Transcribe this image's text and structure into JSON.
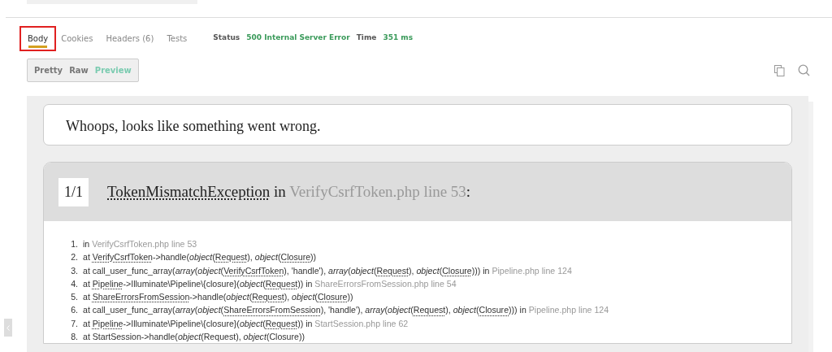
{
  "tabs": [
    {
      "label": "Body",
      "selected": true,
      "annotated": true
    },
    {
      "label": "Cookies",
      "selected": false,
      "annotated": false
    },
    {
      "label": "Headers (6)",
      "selected": false,
      "annotated": false
    },
    {
      "label": "Tests",
      "selected": false,
      "annotated": false
    }
  ],
  "status": {
    "label": "Status",
    "value": "500 Internal Server Error",
    "time_label": "Time",
    "time_value": "351 ms"
  },
  "view_modes": [
    {
      "label": "Pretty",
      "selected": false
    },
    {
      "label": "Raw",
      "selected": false
    },
    {
      "label": "Preview",
      "selected": true
    }
  ],
  "preview": {
    "title": "Whoops, looks like something went wrong.",
    "exception": {
      "count": "1/1",
      "parts": [
        {
          "kind": "abbr",
          "text": "TokenMismatchException"
        },
        {
          "kind": "text",
          "text": " in "
        },
        {
          "kind": "file",
          "text": "VerifyCsrfToken.php line 53"
        },
        {
          "kind": "text",
          "text": ":"
        }
      ]
    },
    "trace": [
      {
        "number": "1.",
        "parts": [
          {
            "kind": "text",
            "text": "in "
          },
          {
            "kind": "file",
            "text": "VerifyCsrfToken.php line 53"
          }
        ]
      },
      {
        "number": "2.",
        "parts": [
          {
            "kind": "text",
            "text": "at "
          },
          {
            "kind": "abbr",
            "text": "VerifyCsrfToken"
          },
          {
            "kind": "text",
            "text": "->handle("
          },
          {
            "kind": "italic",
            "text": "object"
          },
          {
            "kind": "text",
            "text": "("
          },
          {
            "kind": "abbr",
            "text": "Request"
          },
          {
            "kind": "text",
            "text": "), "
          },
          {
            "kind": "italic",
            "text": "object"
          },
          {
            "kind": "text",
            "text": "("
          },
          {
            "kind": "abbr",
            "text": "Closure"
          },
          {
            "kind": "text",
            "text": "))"
          }
        ]
      },
      {
        "number": "3.",
        "parts": [
          {
            "kind": "text",
            "text": "at call_user_func_array("
          },
          {
            "kind": "italic",
            "text": "array"
          },
          {
            "kind": "text",
            "text": "("
          },
          {
            "kind": "italic",
            "text": "object"
          },
          {
            "kind": "text",
            "text": "("
          },
          {
            "kind": "abbr",
            "text": "VerifyCsrfToken"
          },
          {
            "kind": "text",
            "text": "), 'handle'), "
          },
          {
            "kind": "italic",
            "text": "array"
          },
          {
            "kind": "text",
            "text": "("
          },
          {
            "kind": "italic",
            "text": "object"
          },
          {
            "kind": "text",
            "text": "("
          },
          {
            "kind": "abbr",
            "text": "Request"
          },
          {
            "kind": "text",
            "text": "), "
          },
          {
            "kind": "italic",
            "text": "object"
          },
          {
            "kind": "text",
            "text": "("
          },
          {
            "kind": "abbr",
            "text": "Closure"
          },
          {
            "kind": "text",
            "text": "))) in "
          },
          {
            "kind": "file",
            "text": "Pipeline.php line 124"
          }
        ]
      },
      {
        "number": "4.",
        "parts": [
          {
            "kind": "text",
            "text": "at "
          },
          {
            "kind": "abbr",
            "text": "Pipeline"
          },
          {
            "kind": "text",
            "text": "->Illuminate\\Pipeline\\{closure}("
          },
          {
            "kind": "italic",
            "text": "object"
          },
          {
            "kind": "text",
            "text": "("
          },
          {
            "kind": "abbr",
            "text": "Request"
          },
          {
            "kind": "text",
            "text": ")) in "
          },
          {
            "kind": "file",
            "text": "ShareErrorsFromSession.php line 54"
          }
        ]
      },
      {
        "number": "5.",
        "parts": [
          {
            "kind": "text",
            "text": "at "
          },
          {
            "kind": "abbr",
            "text": "ShareErrorsFromSession"
          },
          {
            "kind": "text",
            "text": "->handle("
          },
          {
            "kind": "italic",
            "text": "object"
          },
          {
            "kind": "text",
            "text": "("
          },
          {
            "kind": "abbr",
            "text": "Request"
          },
          {
            "kind": "text",
            "text": "), "
          },
          {
            "kind": "italic",
            "text": "object"
          },
          {
            "kind": "text",
            "text": "("
          },
          {
            "kind": "abbr",
            "text": "Closure"
          },
          {
            "kind": "text",
            "text": "))"
          }
        ]
      },
      {
        "number": "6.",
        "parts": [
          {
            "kind": "text",
            "text": "at call_user_func_array("
          },
          {
            "kind": "italic",
            "text": "array"
          },
          {
            "kind": "text",
            "text": "("
          },
          {
            "kind": "italic",
            "text": "object"
          },
          {
            "kind": "text",
            "text": "("
          },
          {
            "kind": "abbr",
            "text": "ShareErrorsFromSession"
          },
          {
            "kind": "text",
            "text": "), 'handle'), "
          },
          {
            "kind": "italic",
            "text": "array"
          },
          {
            "kind": "text",
            "text": "("
          },
          {
            "kind": "italic",
            "text": "object"
          },
          {
            "kind": "text",
            "text": "("
          },
          {
            "kind": "abbr",
            "text": "Request"
          },
          {
            "kind": "text",
            "text": "), "
          },
          {
            "kind": "italic",
            "text": "object"
          },
          {
            "kind": "text",
            "text": "("
          },
          {
            "kind": "abbr",
            "text": "Closure"
          },
          {
            "kind": "text",
            "text": "))) in "
          },
          {
            "kind": "file",
            "text": "Pipeline.php line 124"
          }
        ]
      },
      {
        "number": "7.",
        "parts": [
          {
            "kind": "text",
            "text": "at "
          },
          {
            "kind": "abbr",
            "text": "Pipeline"
          },
          {
            "kind": "text",
            "text": "->Illuminate\\Pipeline\\{closure}("
          },
          {
            "kind": "italic",
            "text": "object"
          },
          {
            "kind": "text",
            "text": "("
          },
          {
            "kind": "abbr",
            "text": "Request"
          },
          {
            "kind": "text",
            "text": ")) in "
          },
          {
            "kind": "file",
            "text": "StartSession.php line 62"
          }
        ]
      },
      {
        "number": "8.",
        "parts": [
          {
            "kind": "text",
            "text": "at StartSession->handle("
          },
          {
            "kind": "italic",
            "text": "object"
          },
          {
            "kind": "text",
            "text": "(Request), "
          },
          {
            "kind": "italic",
            "text": "object"
          },
          {
            "kind": "text",
            "text": "(Closure))"
          }
        ]
      }
    ]
  }
}
